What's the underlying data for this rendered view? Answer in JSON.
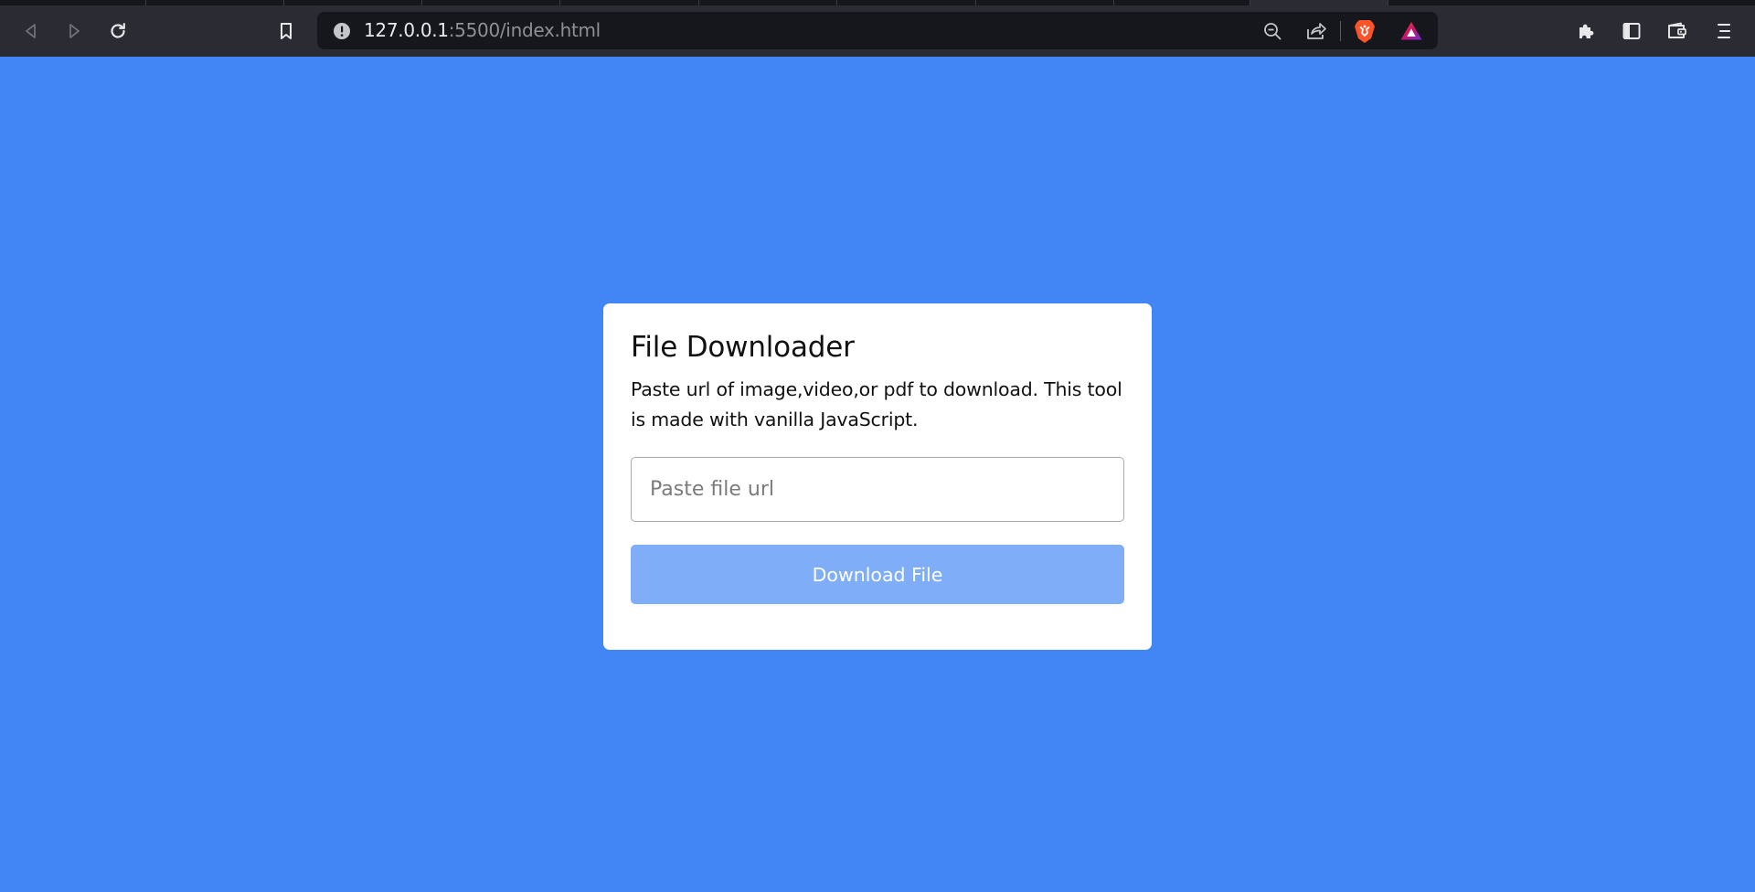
{
  "browser": {
    "address": {
      "host": "127.0.0.1",
      "path": ":5500/index.html"
    },
    "icons": {
      "back": "back-icon",
      "forward": "forward-icon",
      "reload": "reload-icon",
      "bookmark": "bookmark-icon",
      "site_info": "info-icon",
      "zoom": "zoom-out-icon",
      "share": "share-icon",
      "shields": "brave-shields-icon",
      "rewards": "brave-rewards-icon",
      "extensions": "puzzle-icon",
      "sidebar": "sidebar-icon",
      "wallet": "wallet-icon",
      "menu": "hamburger-menu-icon"
    }
  },
  "page": {
    "background_color": "#4285f4",
    "title": "File Downloader",
    "description": "Paste url of image,video,or pdf to download. This tool is made with vanilla JavaScript.",
    "input": {
      "value": "",
      "placeholder": "Paste file url"
    },
    "button_label": "Download File",
    "button_color": "#80adf8"
  }
}
